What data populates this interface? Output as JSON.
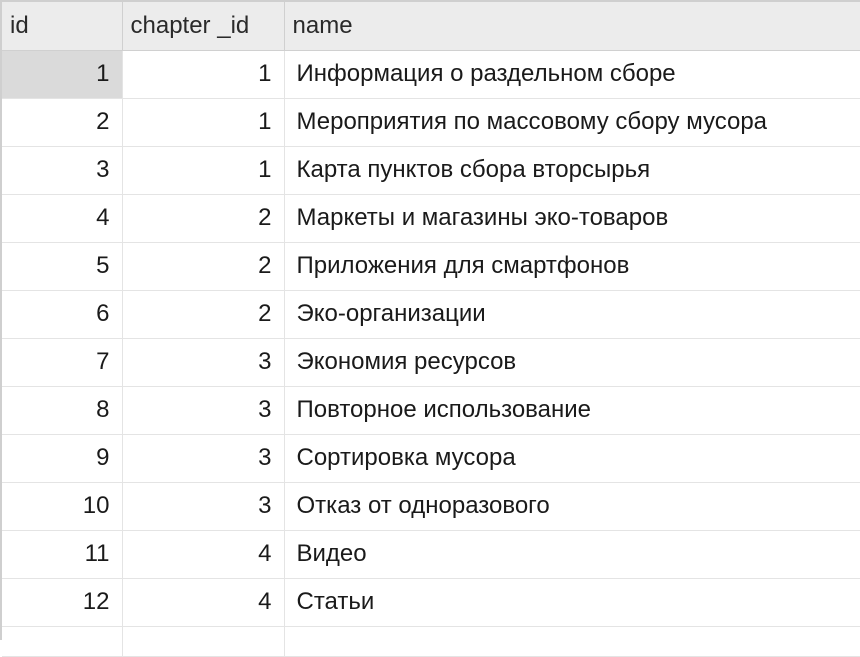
{
  "columns": [
    "id",
    "chapter _id",
    "name"
  ],
  "rows": [
    {
      "id": "1",
      "chapter_id": "1",
      "name": "Информация о раздельном сборе"
    },
    {
      "id": "2",
      "chapter_id": "1",
      "name": "Мероприятия по массовому сбору мусора"
    },
    {
      "id": "3",
      "chapter_id": "1",
      "name": "Карта пунктов сбора вторсырья"
    },
    {
      "id": "4",
      "chapter_id": "2",
      "name": "Маркеты и магазины эко-товаров"
    },
    {
      "id": "5",
      "chapter_id": "2",
      "name": "Приложения для смартфонов"
    },
    {
      "id": "6",
      "chapter_id": "2",
      "name": "Эко-организации"
    },
    {
      "id": "7",
      "chapter_id": "3",
      "name": "Экономия ресурсов"
    },
    {
      "id": "8",
      "chapter_id": "3",
      "name": "Повторное использование"
    },
    {
      "id": "9",
      "chapter_id": "3",
      "name": "Сортировка мусора"
    },
    {
      "id": "10",
      "chapter_id": "3",
      "name": "Отказ от одноразового"
    },
    {
      "id": "11",
      "chapter_id": "4",
      "name": "Видео"
    },
    {
      "id": "12",
      "chapter_id": "4",
      "name": "Статьи"
    }
  ],
  "selected_row_index": 0,
  "colors": {
    "header_bg": "#ececec",
    "selected_cell_bg": "#dadada",
    "grid_line": "#e4e4e4"
  }
}
